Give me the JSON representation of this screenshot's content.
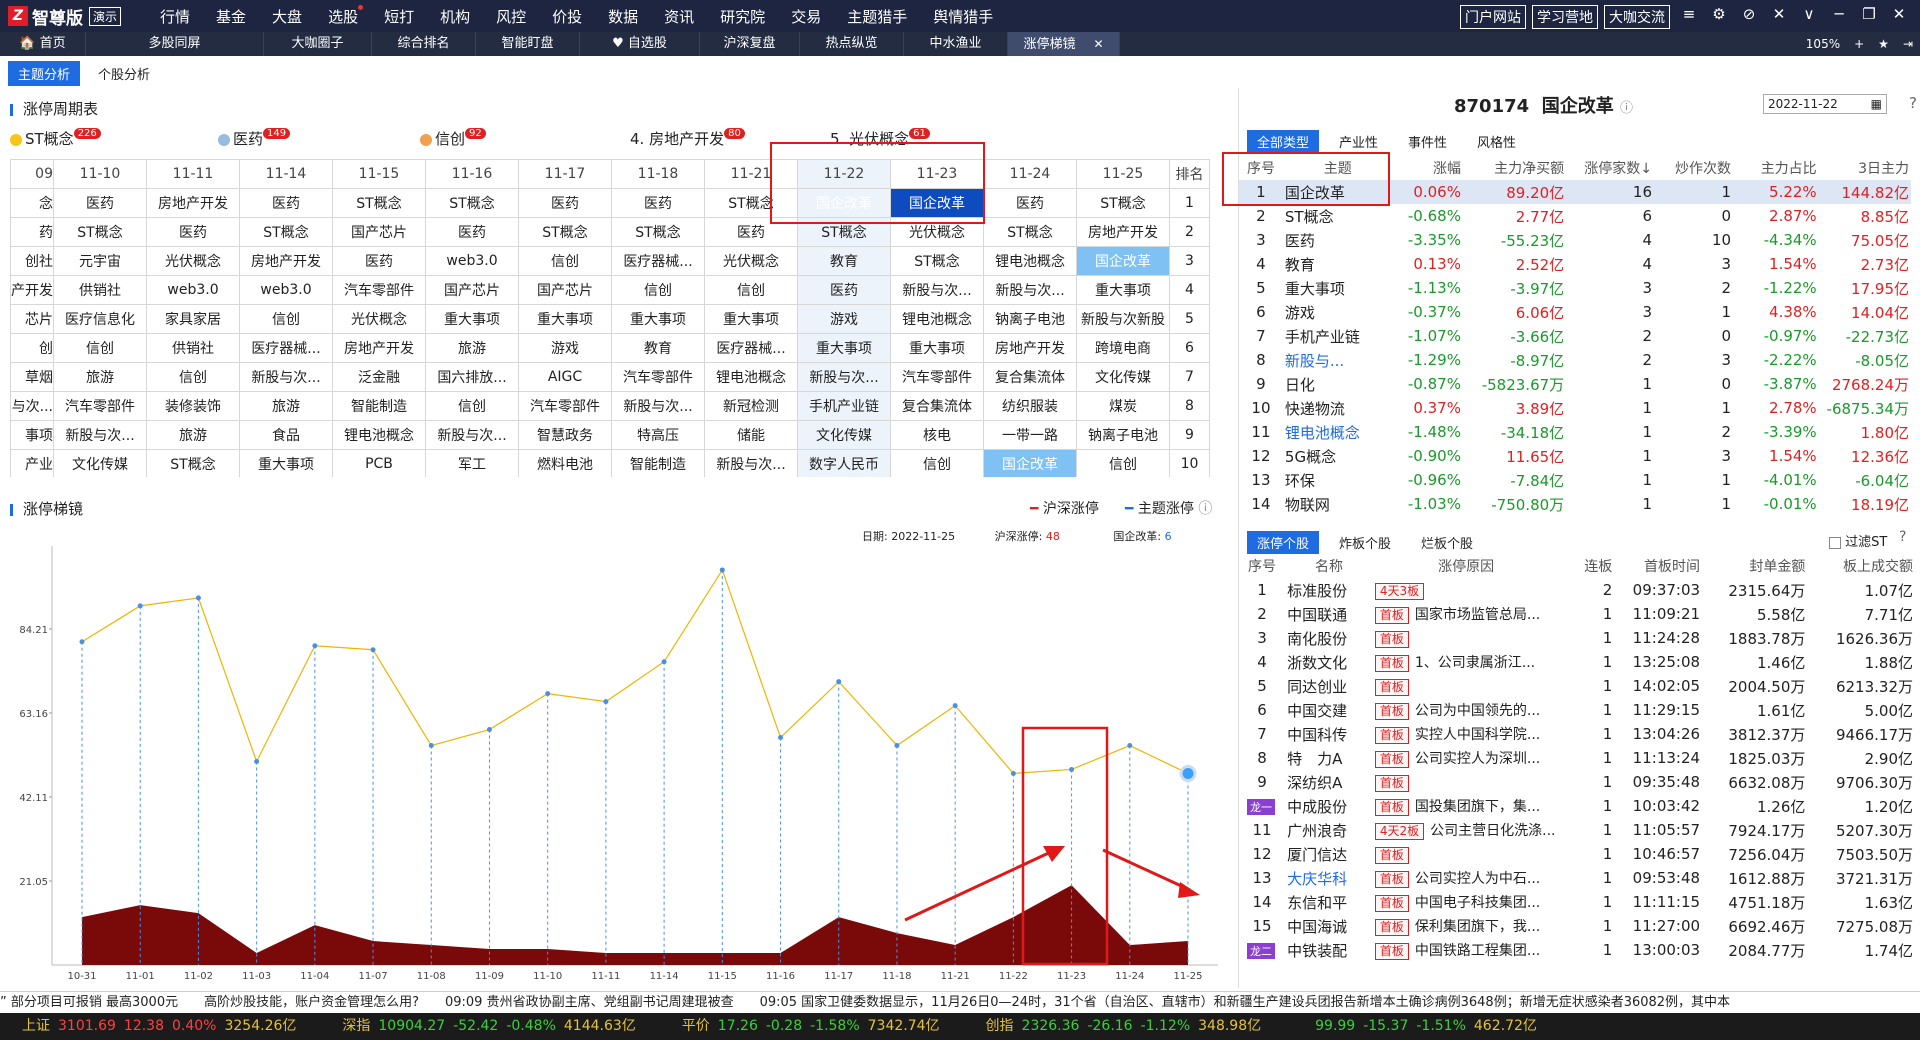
{
  "app": {
    "logo_mark": "Z",
    "name": "智尊版",
    "badge": "演示"
  },
  "menu": [
    "行情",
    "基金",
    "大盘",
    "选股",
    "短打",
    "机构",
    "风控",
    "价投",
    "数据",
    "资讯",
    "研究院",
    "交易",
    "主题猎手",
    "舆情猎手"
  ],
  "right_links": [
    "门户网站",
    "学习营地",
    "大咖交流"
  ],
  "window_icons": [
    "≡",
    "⚙",
    "⊘",
    "✕",
    "∨",
    "─",
    "❐",
    "✕"
  ],
  "tabs": [
    "🏠 首页",
    "多股同屏",
    "大咖圈子",
    "综合排名",
    "智能盯盘",
    "♥ 自选股",
    "沪深复盘",
    "热点纵览",
    "中水渔业",
    "涨停梯镜"
  ],
  "zoom": {
    "value": "105%",
    "icons": [
      "+",
      "★",
      "⇥"
    ]
  },
  "subtabs": [
    "主题分析",
    "个股分析"
  ],
  "cycle_title": "涨停周期表",
  "concepts": [
    {
      "label": "ST概念",
      "count": "226",
      "bulb": "yellow"
    },
    {
      "label": "医药",
      "count": "149",
      "bulb": "blue"
    },
    {
      "label": "信创",
      "count": "92",
      "bulb": "orange"
    },
    {
      "label": "4. 房地产开发",
      "count": "80",
      "bulb": ""
    },
    {
      "label": "5. 光伏概念",
      "count": "61",
      "bulb": ""
    }
  ],
  "grid": {
    "dates": [
      "09",
      "11-10",
      "11-11",
      "11-14",
      "11-15",
      "11-16",
      "11-17",
      "11-18",
      "11-21",
      "11-22",
      "11-23",
      "11-24",
      "11-25"
    ],
    "rank_label": "排名",
    "rows": [
      [
        "念",
        "医药",
        "房地产开发",
        "医药",
        "ST概念",
        "ST概念",
        "医药",
        "医药",
        "ST概念",
        "国企改革",
        "国企改革",
        "医药",
        "ST概念",
        "1"
      ],
      [
        "药",
        "ST概念",
        "医药",
        "ST概念",
        "国产芯片",
        "医药",
        "ST概念",
        "ST概念",
        "医药",
        "ST概念",
        "光伏概念",
        "ST概念",
        "房地产开发",
        "2"
      ],
      [
        "创社",
        "元宇宙",
        "光伏概念",
        "房地产开发",
        "医药",
        "web3.0",
        "信创",
        "医疗器械...",
        "光伏概念",
        "教育",
        "ST概念",
        "锂电池概念",
        "国企改革",
        "3"
      ],
      [
        "产开发",
        "供销社",
        "web3.0",
        "web3.0",
        "汽车零部件",
        "国产芯片",
        "国产芯片",
        "信创",
        "信创",
        "医药",
        "新股与次...",
        "新股与次...",
        "重大事项",
        "4"
      ],
      [
        "芯片",
        "医疗信息化",
        "家具家居",
        "信创",
        "光伏概念",
        "重大事项",
        "重大事项",
        "重大事项",
        "重大事项",
        "游戏",
        "锂电池概念",
        "钠离子电池",
        "新股与次新股",
        "5"
      ],
      [
        "创",
        "信创",
        "供销社",
        "医疗器械...",
        "房地产开发",
        "旅游",
        "游戏",
        "教育",
        "医疗器械...",
        "重大事项",
        "重大事项",
        "房地产开发",
        "跨境电商",
        "6"
      ],
      [
        "草烟",
        "旅游",
        "信创",
        "新股与次...",
        "泛金融",
        "国六排放...",
        "AIGC",
        "汽车零部件",
        "锂电池概念",
        "新股与次...",
        "汽车零部件",
        "复合集流体",
        "文化传媒",
        "7"
      ],
      [
        "与次...",
        "汽车零部件",
        "装修装饰",
        "旅游",
        "智能制造",
        "信创",
        "汽车零部件",
        "新股与次...",
        "新冠检测",
        "手机产业链",
        "复合集流体",
        "纺织服装",
        "煤炭",
        "8"
      ],
      [
        "事项",
        "新股与次...",
        "旅游",
        "食品",
        "锂电池概念",
        "新股与次...",
        "智慧政务",
        "特高压",
        "储能",
        "文化传媒",
        "核电",
        "一带一路",
        "钠离子电池",
        "9"
      ],
      [
        "产业",
        "文化传媒",
        "ST概念",
        "重大事项",
        "PCB",
        "军工",
        "燃料电池",
        "智能制造",
        "新股与次...",
        "数字人民币",
        "信创",
        "国企改革",
        "信创",
        "10"
      ]
    ]
  },
  "ladder": {
    "title": "涨停梯镜",
    "legend": [
      {
        "label": "沪深涨停",
        "color": "#e02020"
      },
      {
        "label": "主题涨停",
        "color": "#1e6ce0"
      }
    ],
    "info": {
      "date_label": "日期:",
      "date": "2022-11-25",
      "total_label": "沪深涨停:",
      "total": "48",
      "theme_label": "国企改革:",
      "theme": "6"
    }
  },
  "chart_data": {
    "type": "line",
    "x": [
      "10-31",
      "11-01",
      "11-02",
      "11-03",
      "11-04",
      "11-07",
      "11-08",
      "11-09",
      "11-10",
      "11-11",
      "11-14",
      "11-15",
      "11-16",
      "11-17",
      "11-18",
      "11-21",
      "11-22",
      "11-23",
      "11-24",
      "11-25"
    ],
    "yticks": [
      "21.05",
      "42.11",
      "63.16",
      "84.21"
    ],
    "ylim": [
      0,
      105
    ],
    "series": [
      {
        "name": "沪深涨停",
        "color": "#f0b400",
        "values": [
          81,
          90,
          92,
          51,
          80,
          79,
          55,
          59,
          68,
          66,
          76,
          99,
          57,
          71,
          55,
          65,
          48,
          49,
          55,
          48
        ]
      },
      {
        "name": "主题涨停",
        "color": "#7a0a0a",
        "values": [
          12,
          15,
          13,
          3,
          10,
          6,
          5,
          4,
          4,
          3,
          3,
          3,
          3,
          12,
          8,
          5,
          12,
          20,
          5,
          6
        ]
      }
    ]
  },
  "right": {
    "code": "870174",
    "name": "国企改革",
    "date": "2022-11-22",
    "type_tabs": [
      "全部类型",
      "产业性",
      "事件性",
      "风格性"
    ],
    "theme_headers": [
      "序号",
      "主题",
      "涨幅",
      "主力净买额",
      "涨停家数↓",
      "炒作次数",
      "主力占比",
      "3日主力"
    ],
    "themes": [
      [
        "1",
        "国企改革",
        "0.06%",
        "89.20亿",
        "16",
        "1",
        "5.22%",
        "144.82亿"
      ],
      [
        "2",
        "ST概念",
        "-0.68%",
        "2.77亿",
        "6",
        "0",
        "2.87%",
        "8.85亿"
      ],
      [
        "3",
        "医药",
        "-3.35%",
        "-55.23亿",
        "4",
        "10",
        "-4.34%",
        "75.05亿"
      ],
      [
        "4",
        "教育",
        "0.13%",
        "2.52亿",
        "4",
        "3",
        "1.54%",
        "2.73亿"
      ],
      [
        "5",
        "重大事项",
        "-1.13%",
        "-3.97亿",
        "3",
        "2",
        "-1.22%",
        "17.95亿"
      ],
      [
        "6",
        "游戏",
        "-0.37%",
        "6.06亿",
        "3",
        "1",
        "4.38%",
        "14.04亿"
      ],
      [
        "7",
        "手机产业链",
        "-1.07%",
        "-3.66亿",
        "2",
        "0",
        "-0.97%",
        "-22.73亿"
      ],
      [
        "8",
        "新股与...",
        "-1.29%",
        "-8.97亿",
        "2",
        "3",
        "-2.22%",
        "-8.05亿"
      ],
      [
        "9",
        "日化",
        "-0.87%",
        "-5823.67万",
        "1",
        "0",
        "-3.87%",
        "2768.24万"
      ],
      [
        "10",
        "快递物流",
        "0.37%",
        "3.89亿",
        "1",
        "1",
        "2.78%",
        "-6875.34万"
      ],
      [
        "11",
        "锂电池概念",
        "-1.48%",
        "-34.18亿",
        "1",
        "2",
        "-3.39%",
        "1.80亿"
      ],
      [
        "12",
        "5G概念",
        "-0.90%",
        "11.65亿",
        "1",
        "3",
        "1.54%",
        "12.36亿"
      ],
      [
        "13",
        "环保",
        "-0.96%",
        "-7.84亿",
        "1",
        "1",
        "-4.01%",
        "-6.04亿"
      ],
      [
        "14",
        "物联网",
        "-1.03%",
        "-750.80万",
        "1",
        "1",
        "-0.01%",
        "18.19亿"
      ]
    ],
    "stock_tabs": [
      "涨停个股",
      "炸板个股",
      "烂板个股"
    ],
    "filter_st": "过滤ST",
    "stock_headers": [
      "序号",
      "名称",
      "涨停原因",
      "连板",
      "首板时间",
      "封单金额",
      "板上成交额"
    ],
    "stocks": [
      [
        "1",
        "标准股份",
        "4天3板",
        "",
        "2",
        "09:37:03",
        "2315.64万",
        "1.07亿",
        ""
      ],
      [
        "2",
        "中国联通",
        "首板",
        "国家市场监管总局...",
        "1",
        "11:09:21",
        "5.58亿",
        "7.71亿",
        ""
      ],
      [
        "3",
        "南化股份",
        "首板",
        "",
        "1",
        "11:24:28",
        "1883.78万",
        "1626.36万",
        ""
      ],
      [
        "4",
        "浙数文化",
        "首板",
        "1、公司隶属浙江...",
        "1",
        "13:25:08",
        "1.46亿",
        "1.88亿",
        ""
      ],
      [
        "5",
        "同达创业",
        "首板",
        "",
        "1",
        "14:02:05",
        "2004.50万",
        "6213.32万",
        ""
      ],
      [
        "6",
        "中国交建",
        "首板",
        "公司为中国领先的...",
        "1",
        "11:29:15",
        "1.61亿",
        "5.00亿",
        ""
      ],
      [
        "7",
        "中国科传",
        "首板",
        "实控人中国科学院...",
        "1",
        "13:04:26",
        "3812.37万",
        "9466.17万",
        ""
      ],
      [
        "8",
        "特　力A",
        "首板",
        "公司实控人为深圳...",
        "1",
        "11:13:24",
        "1825.03万",
        "2.90亿",
        ""
      ],
      [
        "9",
        "深纺织A",
        "首板",
        "",
        "1",
        "09:35:48",
        "6632.08万",
        "9706.30万",
        ""
      ],
      [
        "10",
        "中成股份",
        "首板",
        "国投集团旗下，集...",
        "1",
        "10:03:42",
        "1.26亿",
        "1.20亿",
        "龙一"
      ],
      [
        "11",
        "广州浪奇",
        "4天2板",
        "公司主营日化洗涤...",
        "1",
        "11:05:57",
        "7924.17万",
        "5207.30万",
        ""
      ],
      [
        "12",
        "厦门信达",
        "首板",
        "",
        "1",
        "10:46:57",
        "7256.04万",
        "7503.50万",
        ""
      ],
      [
        "13",
        "大庆华科",
        "首板",
        "公司实控人为中石...",
        "1",
        "09:53:48",
        "1612.88万",
        "3721.31万",
        ""
      ],
      [
        "14",
        "东信和平",
        "首板",
        "中国电子科技集团...",
        "1",
        "11:11:15",
        "4751.18万",
        "1.63亿",
        ""
      ],
      [
        "15",
        "中国海诚",
        "首板",
        "保利集团旗下，我...",
        "1",
        "11:27:00",
        "6692.46万",
        "7275.08万",
        ""
      ],
      [
        "16",
        "中铁装配",
        "首板",
        "中国铁路工程集团...",
        "1",
        "13:00:03",
        "2084.77万",
        "1.74亿",
        "龙二"
      ]
    ]
  },
  "news": "” 部分项目可报销 最高3000元　　高阶炒股技能，账户资金管理怎么用?　　09:09 贵州省政协副主席、党组副书记周建琨被查　　09:05 国家卫健委数据显示，11月26日0—24时，31个省（自治区、直辖市）和新疆生产建设兵团报告新增本土确诊病例3648例；新增无症状感染者36082例，其中本",
  "status": [
    {
      "name": "上证",
      "price": "3101.69",
      "chg": "12.38",
      "pct": "0.40%",
      "amt": "3254.26亿",
      "dir": "up"
    },
    {
      "name": "深指",
      "price": "10904.27",
      "chg": "-52.42",
      "pct": "-0.48%",
      "amt": "4144.63亿",
      "dir": "down"
    },
    {
      "name": "平价",
      "price": "17.26",
      "chg": "-0.28",
      "pct": "-1.58%",
      "amt": "7342.74亿",
      "dir": "down"
    },
    {
      "name": "创指",
      "price": "2326.36",
      "chg": "-26.16",
      "pct": "-1.12%",
      "amt": "348.98亿",
      "dir": "down"
    },
    {
      "name": "",
      "price": "99.99",
      "chg": "-15.37",
      "pct": "-1.51%",
      "amt": "462.72亿",
      "dir": "down"
    }
  ]
}
